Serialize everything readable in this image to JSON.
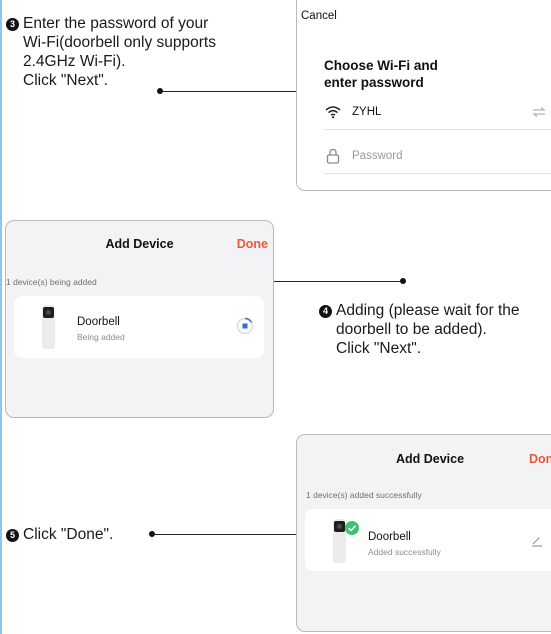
{
  "steps": {
    "step3": {
      "number": "3",
      "lines": [
        "Enter the password of your",
        "Wi-Fi(doorbell only supports",
        "2.4GHz Wi-Fi).",
        "Click \"Next\"."
      ]
    },
    "step4": {
      "number": "4",
      "lines": [
        "Adding (please wait for the",
        "doorbell to be added).",
        "Click \"Next\"."
      ]
    },
    "step5": {
      "number": "5",
      "lines": [
        "Click \"Done\"."
      ]
    }
  },
  "wifi_screen": {
    "cancel_label": "Cancel",
    "heading_line1": "Choose Wi-Fi and",
    "heading_line2": "enter password",
    "ssid": "ZYHL",
    "ssid_icon": "wifi-icon",
    "switch_icon": "switch-network-icon",
    "password_placeholder": "Password",
    "password_icon": "lock-icon"
  },
  "adding_screen": {
    "title": "Add Device",
    "done_label": "Done",
    "caption": "1 device(s) being added",
    "device_name": "Doorbell",
    "device_status": "Being added",
    "progress_icon": "loading-spinner-icon"
  },
  "done_screen": {
    "title": "Add Device",
    "done_label": "Done",
    "caption": "1 device(s) added successfully",
    "device_name": "Doorbell",
    "device_status": "Added successfully",
    "check_icon": "success-check-icon",
    "edit_icon": "edit-icon"
  },
  "colors": {
    "accent": "#e55a3c",
    "success": "#3cc46a",
    "progress": "#2f6fd6",
    "rule": "#8fc6e8"
  }
}
